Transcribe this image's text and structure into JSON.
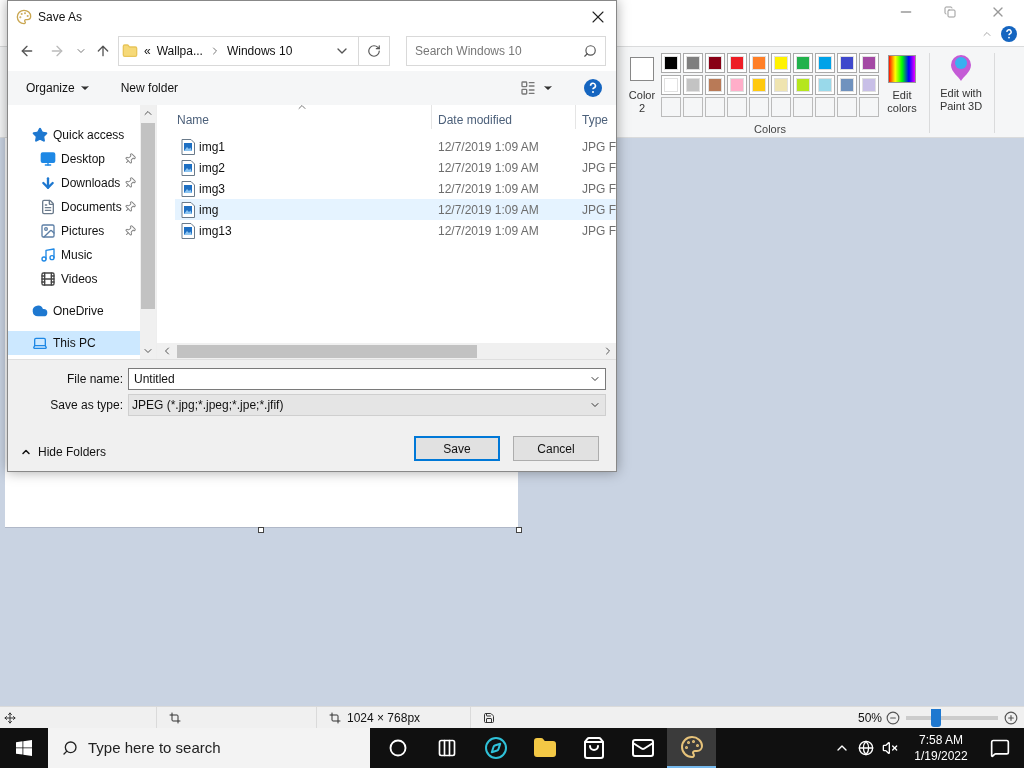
{
  "paint": {
    "color2": {
      "label": "Color 2",
      "color": "#ffffff"
    },
    "palette": [
      {
        "color": "#000000"
      },
      {
        "color": "#7f7f7f"
      },
      {
        "color": "#880015"
      },
      {
        "color": "#ed1c24"
      },
      {
        "color": "#ff7f27"
      },
      {
        "color": "#fff200"
      },
      {
        "color": "#22b14c"
      },
      {
        "color": "#00a2e8"
      },
      {
        "color": "#3f48cc"
      },
      {
        "color": "#a349a4"
      },
      {
        "color": "#ffffff"
      },
      {
        "color": "#c3c3c3"
      },
      {
        "color": "#b97a57"
      },
      {
        "color": "#ffaec9"
      },
      {
        "color": "#ffc90e"
      },
      {
        "color": "#efe4b0"
      },
      {
        "color": "#b5e61d"
      },
      {
        "color": "#99d9ea"
      },
      {
        "color": "#7092be"
      },
      {
        "color": "#c8bfe7"
      }
    ],
    "edit_colors": "Edit colors",
    "edit_paint3d": "Edit with Paint 3D",
    "group_label": "Colors"
  },
  "dialog": {
    "title": "Save As",
    "breadcrumb_overflow": "«",
    "breadcrumb": [
      "Wallpa...",
      "Windows 10"
    ],
    "search_placeholder": "Search Windows 10",
    "organize": "Organize",
    "new_folder": "New folder",
    "nav": [
      {
        "label": "Quick access",
        "kind": "star",
        "selected": false,
        "children": [
          {
            "label": "Desktop",
            "kind": "desktop",
            "pinned": true,
            "selected": false
          },
          {
            "label": "Downloads",
            "kind": "download",
            "pinned": true,
            "selected": false
          },
          {
            "label": "Documents",
            "kind": "document",
            "pinned": true,
            "selected": false
          },
          {
            "label": "Pictures",
            "kind": "picture",
            "pinned": true,
            "selected": false
          },
          {
            "label": "Music",
            "kind": "music",
            "pinned": false,
            "selected": false
          },
          {
            "label": "Videos",
            "kind": "video",
            "pinned": false,
            "selected": false
          }
        ]
      },
      {
        "label": "OneDrive",
        "kind": "cloud",
        "selected": false
      },
      {
        "label": "This PC",
        "kind": "pc",
        "selected": true
      }
    ],
    "columns": [
      "Name",
      "Date modified",
      "Type"
    ],
    "rows": [
      {
        "name": "img1",
        "date": "12/7/2019 1:09 AM",
        "type": "JPG F",
        "hovered": false
      },
      {
        "name": "img2",
        "date": "12/7/2019 1:09 AM",
        "type": "JPG F",
        "hovered": false
      },
      {
        "name": "img3",
        "date": "12/7/2019 1:09 AM",
        "type": "JPG F",
        "hovered": false
      },
      {
        "name": "img",
        "date": "12/7/2019 1:09 AM",
        "type": "JPG F",
        "hovered": true
      },
      {
        "name": "img13",
        "date": "12/7/2019 1:09 AM",
        "type": "JPG F",
        "hovered": false
      }
    ],
    "file_name_label": "File name:",
    "file_name": "Untitled",
    "type_label": "Save as type:",
    "type_value": "JPEG (*.jpg;*.jpeg;*.jpe;*.jfif)",
    "hide_folders": "Hide Folders",
    "save": "Save",
    "cancel": "Cancel"
  },
  "status_bar": {
    "dimensions": "1024 × 768px",
    "zoom": "50%",
    "zoom_slider": {
      "level": 0.3
    }
  },
  "taskbar": {
    "search_placeholder": "Type here to search",
    "time": "7:58 AM",
    "date": "1/19/2022",
    "apps": [
      {
        "kind": "cortana",
        "selected": false
      },
      {
        "kind": "taskview",
        "selected": false
      },
      {
        "kind": "edge",
        "selected": false
      },
      {
        "kind": "explorer",
        "selected": false
      },
      {
        "kind": "store",
        "selected": false
      },
      {
        "kind": "mail",
        "selected": false
      },
      {
        "kind": "paint",
        "selected": true
      }
    ]
  }
}
